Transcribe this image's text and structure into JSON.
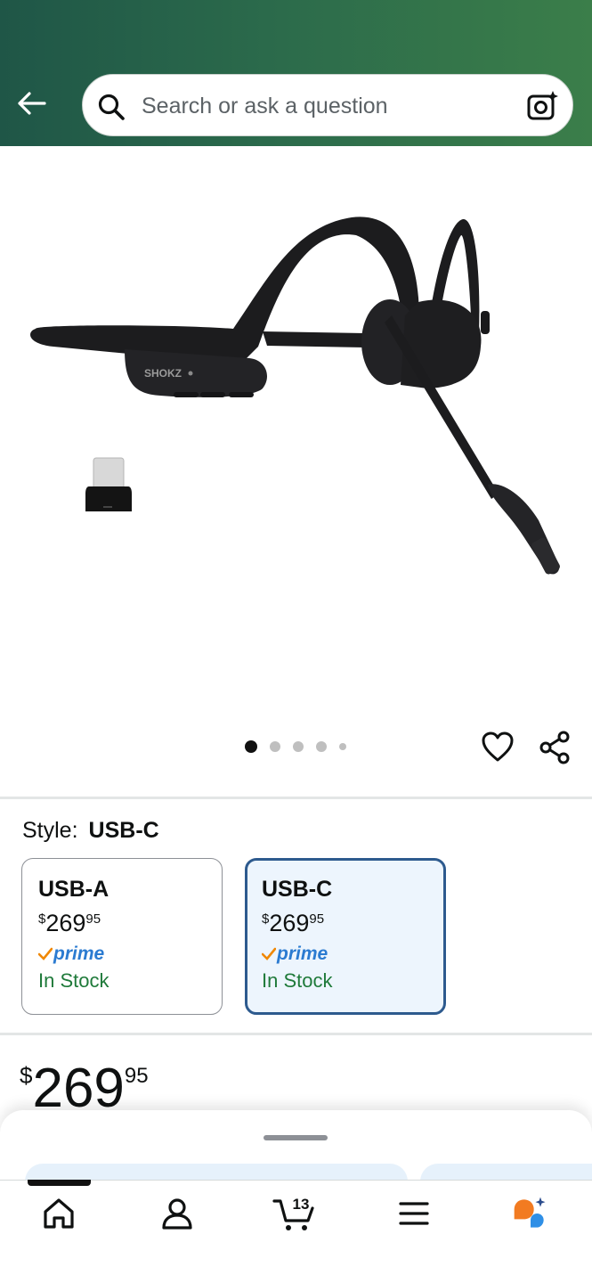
{
  "header": {
    "background": [
      "#1f5647",
      "#3b7e4a"
    ],
    "back_icon": "arrow-left-icon",
    "search": {
      "placeholder": "Search or ask a question",
      "value": "",
      "search_icon": "search-icon",
      "camera_icon": "camera-lens-icon"
    }
  },
  "product": {
    "image_alt": "Shokz bone conduction headset with boom microphone and USB-C dongle",
    "brand_mark": "SHOKZ",
    "carousel": {
      "total": 5,
      "active_index": 0
    },
    "actions": {
      "favorite_icon": "heart-icon",
      "share_icon": "share-icon"
    }
  },
  "style_selector": {
    "label": "Style:",
    "selected": "USB-C",
    "options": [
      {
        "name": "USB-A",
        "currency": "$",
        "price_whole": "269",
        "price_cents": "95",
        "prime_label": "prime",
        "stock": "In Stock",
        "selected": false
      },
      {
        "name": "USB-C",
        "currency": "$",
        "price_whole": "269",
        "price_cents": "95",
        "prime_label": "prime",
        "stock": "In Stock",
        "selected": true
      }
    ]
  },
  "price": {
    "currency": "$",
    "whole": "269",
    "cents": "95"
  },
  "colors": {
    "selected_border": "#2d5a8e",
    "selected_bg": "#edf5fd",
    "prime_blue": "#2b7bd1",
    "prime_check": "#f08804",
    "in_stock_green": "#1f7a3a"
  },
  "bottom_sheet": {
    "handle_icon": "drag-handle-icon"
  },
  "tab_bar": {
    "active": "home",
    "items": [
      {
        "id": "home",
        "icon": "home-icon"
      },
      {
        "id": "account",
        "icon": "user-icon"
      },
      {
        "id": "cart",
        "icon": "cart-icon",
        "count": "13"
      },
      {
        "id": "menu",
        "icon": "hamburger-menu-icon"
      },
      {
        "id": "rufus",
        "icon": "ai-assistant-icon"
      }
    ]
  }
}
